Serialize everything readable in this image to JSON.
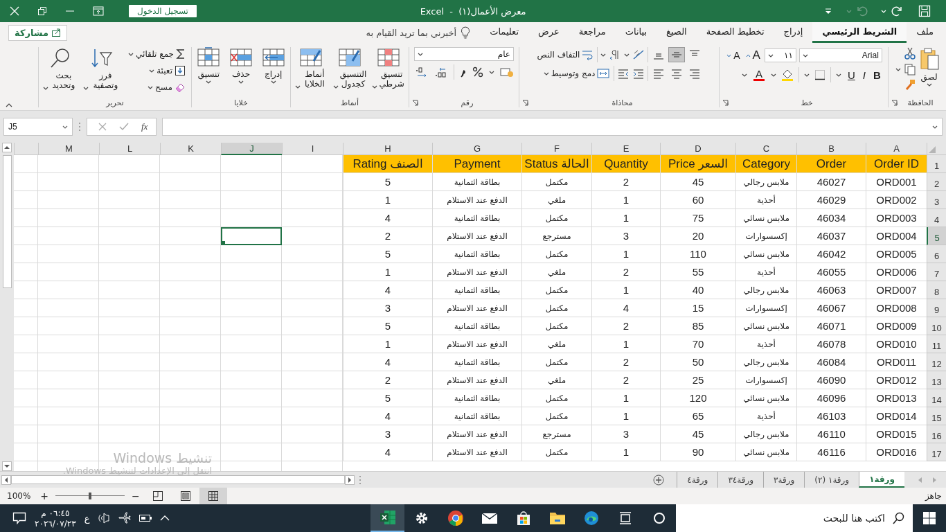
{
  "title_bar": {
    "title": "معرض الأعمال(١)  -  Excel",
    "sign_in": "تسجيل الدخول",
    "undo_disabled": true
  },
  "ribbon_tabs": [
    {
      "label": "ملف",
      "selected": false
    },
    {
      "label": "الشريط الرئيسي",
      "selected": true
    },
    {
      "label": "إدراج",
      "selected": false
    },
    {
      "label": "تخطيط الصفحة",
      "selected": false
    },
    {
      "label": "الصيغ",
      "selected": false
    },
    {
      "label": "بيانات",
      "selected": false
    },
    {
      "label": "مراجعة",
      "selected": false
    },
    {
      "label": "عرض",
      "selected": false
    },
    {
      "label": "تعليمات",
      "selected": false
    }
  ],
  "tell_me": "أخبرني بما تريد القيام به",
  "share_button": "مشاركة",
  "clipboard": {
    "title": "الحافظة",
    "paste": "لصق"
  },
  "font": {
    "title": "خط",
    "font_name": "Arial",
    "font_size": "١١",
    "grow": "A",
    "shrink": "A",
    "bold": "B",
    "italic": "I",
    "underline": "U",
    "font_color": "A"
  },
  "alignment": {
    "title": "محاذاة",
    "wrap_text": "التفاف النص",
    "merge_center": "دمج وتوسيط",
    "vertical_buttons": [
      {
        "kind": "top",
        "selected": false
      },
      {
        "kind": "middle",
        "selected": true
      },
      {
        "kind": "bottom",
        "selected": false
      }
    ],
    "horizontal_buttons": [
      {
        "kind": "right",
        "selected": false
      },
      {
        "kind": "center",
        "selected": false
      },
      {
        "kind": "left",
        "selected": false
      }
    ]
  },
  "number": {
    "title": "رقم",
    "format": "عام"
  },
  "styles": {
    "title": "أنماط",
    "buttons": [
      "تنسيق شرطي",
      "التنسيق كجدول",
      "أنماط الخلايا"
    ]
  },
  "cells": {
    "title": "خلايا",
    "buttons": [
      "إدراج",
      "حذف",
      "تنسيق"
    ]
  },
  "editing": {
    "title": "تحرير",
    "autosum": "جمع تلقائي",
    "fill": "تعبئة",
    "clear": "مسح",
    "sort_filter": "فرز وتصفية",
    "find_select": "بحث وتحديد"
  },
  "formula_bar": {
    "name_box": "J5",
    "function_label": "fx"
  },
  "sheet": {
    "columns": [
      {
        "label": "A",
        "selected": false
      },
      {
        "label": "B",
        "selected": false
      },
      {
        "label": "C",
        "selected": false
      },
      {
        "label": "D",
        "selected": false
      },
      {
        "label": "E",
        "selected": false
      },
      {
        "label": "F",
        "selected": false
      },
      {
        "label": "G",
        "selected": false
      },
      {
        "label": "H",
        "selected": false
      },
      {
        "label": "I",
        "selected": false
      },
      {
        "label": "J",
        "selected": true
      },
      {
        "label": "K",
        "selected": false
      },
      {
        "label": "L",
        "selected": false
      },
      {
        "label": "M",
        "selected": false
      }
    ],
    "row_headers": [
      {
        "label": "1",
        "selected": false
      },
      {
        "label": "2",
        "selected": false
      },
      {
        "label": "3",
        "selected": false
      },
      {
        "label": "4",
        "selected": false
      },
      {
        "label": "5",
        "selected": true
      },
      {
        "label": "6",
        "selected": false
      },
      {
        "label": "7",
        "selected": false
      },
      {
        "label": "8",
        "selected": false
      },
      {
        "label": "9",
        "selected": false
      },
      {
        "label": "10",
        "selected": false
      },
      {
        "label": "11",
        "selected": false
      },
      {
        "label": "12",
        "selected": false
      },
      {
        "label": "13",
        "selected": false
      },
      {
        "label": "14",
        "selected": false
      },
      {
        "label": "15",
        "selected": false
      },
      {
        "label": "16",
        "selected": false
      },
      {
        "label": "17",
        "selected": false
      }
    ],
    "header_row": [
      "Order ID",
      "Order",
      "Category",
      "السعر Price",
      "Quantity",
      "الحالة Status",
      "Payment",
      "الصنف Rating"
    ],
    "rows": [
      [
        "ORD001",
        "46027",
        "ملابس رجالي",
        "45",
        "2",
        "مكتمل",
        "بطاقة ائتمانية",
        "5"
      ],
      [
        "ORD002",
        "46029",
        "أحذية",
        "60",
        "1",
        "ملغي",
        "الدفع عند الاستلام",
        "1"
      ],
      [
        "ORD003",
        "46034",
        "ملابس نسائي",
        "75",
        "1",
        "مكتمل",
        "بطاقة ائتمانية",
        "4"
      ],
      [
        "ORD004",
        "46037",
        "إكسسوارات",
        "20",
        "3",
        "مسترجع",
        "الدفع عند الاستلام",
        "2"
      ],
      [
        "ORD005",
        "46042",
        "ملابس نسائي",
        "110",
        "1",
        "مكتمل",
        "بطاقة ائتمانية",
        "5"
      ],
      [
        "ORD006",
        "46055",
        "أحذية",
        "55",
        "2",
        "ملغي",
        "الدفع عند الاستلام",
        "1"
      ],
      [
        "ORD007",
        "46063",
        "ملابس رجالي",
        "40",
        "1",
        "مكتمل",
        "بطاقة ائتمانية",
        "4"
      ],
      [
        "ORD008",
        "46067",
        "إكسسوارات",
        "15",
        "4",
        "مكتمل",
        "الدفع عند الاستلام",
        "3"
      ],
      [
        "ORD009",
        "46071",
        "ملابس نسائي",
        "85",
        "2",
        "مكتمل",
        "بطاقة ائتمانية",
        "5"
      ],
      [
        "ORD010",
        "46078",
        "أحذية",
        "70",
        "1",
        "ملغي",
        "الدفع عند الاستلام",
        "1"
      ],
      [
        "ORD011",
        "46084",
        "ملابس رجالي",
        "50",
        "2",
        "مكتمل",
        "بطاقة ائتمانية",
        "4"
      ],
      [
        "ORD012",
        "46090",
        "إكسسوارات",
        "25",
        "2",
        "ملغي",
        "الدفع عند الاستلام",
        "2"
      ],
      [
        "ORD013",
        "46096",
        "ملابس نسائي",
        "120",
        "1",
        "مكتمل",
        "بطاقة ائتمانية",
        "5"
      ],
      [
        "ORD014",
        "46103",
        "أحذية",
        "65",
        "1",
        "مكتمل",
        "بطاقة ائتمانية",
        "4"
      ],
      [
        "ORD015",
        "46110",
        "ملابس رجالي",
        "45",
        "3",
        "مسترجع",
        "الدفع عند الاستلام",
        "3"
      ],
      [
        "ORD016",
        "46116",
        "ملابس نسائي",
        "90",
        "1",
        "مكتمل",
        "الدفع عند الاستلام",
        "4"
      ]
    ]
  },
  "sheet_tabs": [
    {
      "label": "ورقة١",
      "selected": true
    },
    {
      "label": "ورقة١ (٢)",
      "selected": false
    },
    {
      "label": "ورقة٣",
      "selected": false
    },
    {
      "label": "ورقة٣٤",
      "selected": false
    },
    {
      "label": "ورقة٤",
      "selected": false
    }
  ],
  "activation": {
    "title": "تنشيط Windows",
    "message": "انتقل إلى الإعدادات لتنشيط Windows."
  },
  "status_bar": {
    "status": "جاهز",
    "views": [
      {
        "kind": "normal",
        "selected": true
      },
      {
        "kind": "page_layout",
        "selected": false
      },
      {
        "kind": "page_break",
        "selected": false
      }
    ],
    "zoom_out": "−",
    "zoom_slider": {
      "level": 0.5
    },
    "zoom_in": "+",
    "zoom": "100%"
  },
  "taskbar": {
    "search_placeholder": "اكتب هنا للبحث",
    "apps": [
      {
        "kind": "cortana",
        "selected": false
      },
      {
        "kind": "task_view",
        "selected": false
      },
      {
        "kind": "edge",
        "selected": false
      },
      {
        "kind": "explorer",
        "selected": false
      },
      {
        "kind": "store",
        "selected": false
      },
      {
        "kind": "mail",
        "selected": false
      },
      {
        "kind": "chrome",
        "selected": false
      },
      {
        "kind": "settings",
        "selected": false
      },
      {
        "kind": "excel",
        "selected": true
      }
    ],
    "language": "ع",
    "time": "٠٦:٤٥ م",
    "date": "٢٠٢٦/٠٧/٢٣"
  }
}
